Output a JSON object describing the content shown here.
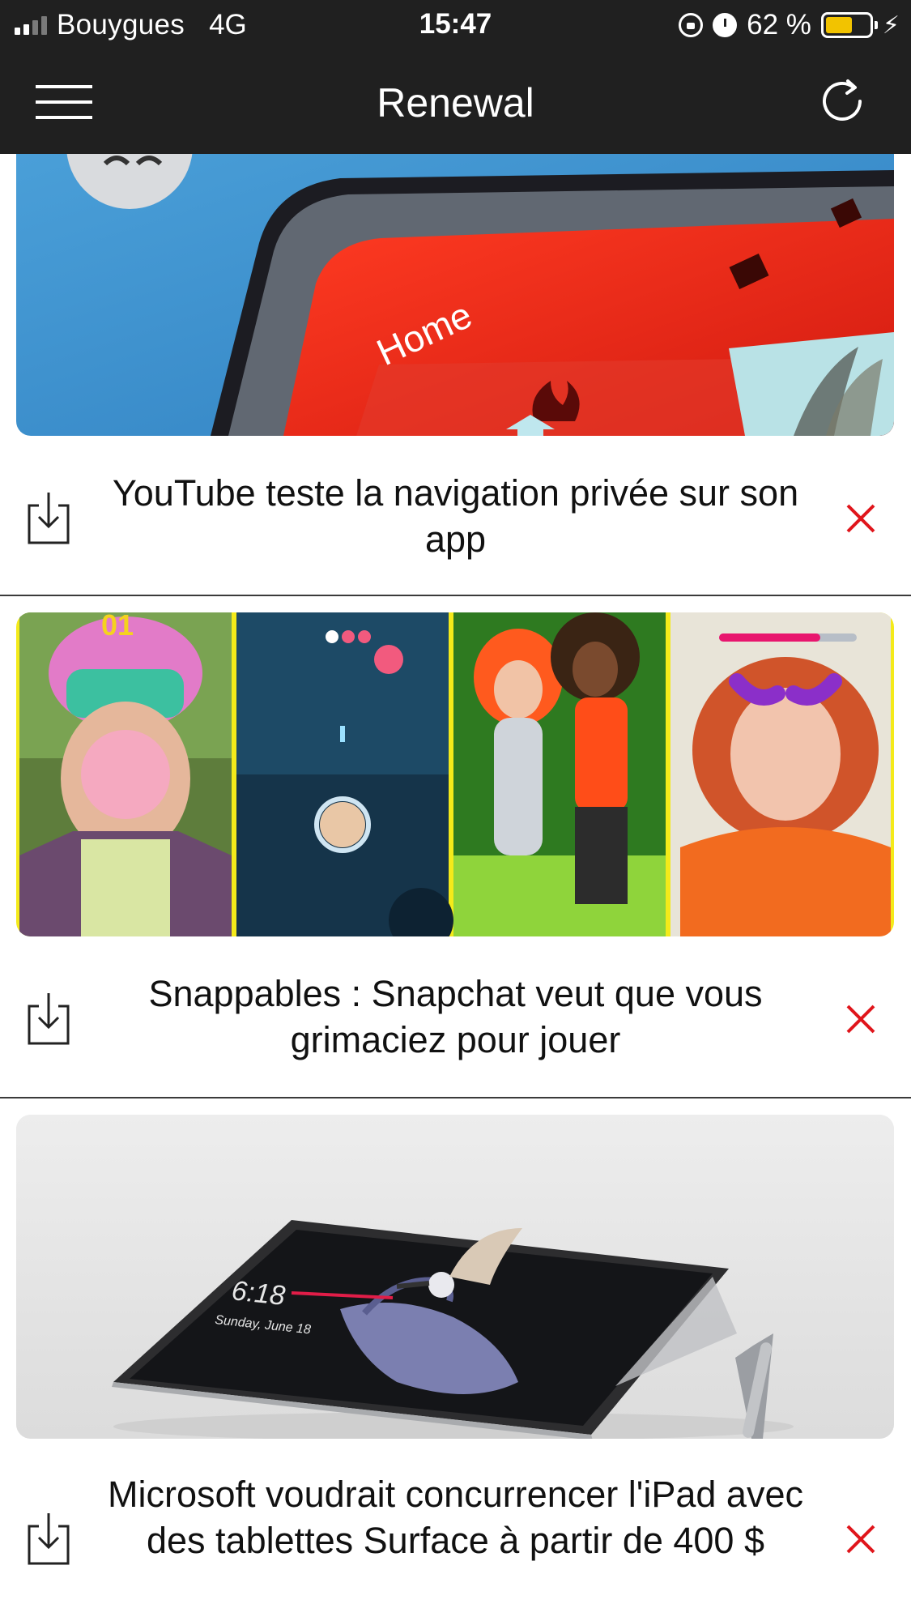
{
  "status_bar": {
    "carrier": "Bouygues",
    "network": "4G",
    "time": "15:47",
    "battery_percent": "62 %",
    "battery_level": 0.62,
    "battery_color": "#f2c300",
    "icons": [
      "signal-icon",
      "orientation-lock-icon",
      "alarm-icon",
      "battery-icon",
      "charging-bolt-icon"
    ]
  },
  "navbar": {
    "title": "Renewal",
    "left_icon": "hamburger-menu-icon",
    "right_icon": "refresh-icon"
  },
  "articles": [
    {
      "title": "YouTube teste la navigation privée sur son app",
      "image_text": "Home",
      "download_icon": "download-icon",
      "dismiss_icon": "close-icon"
    },
    {
      "title": "Snappables : Snapchat veut que vous grimaciez pour jouer",
      "image_text": "",
      "download_icon": "download-icon",
      "dismiss_icon": "close-icon"
    },
    {
      "title": "Microsoft voudrait concurrencer l'iPad avec des tablettes Surface à partir de 400 $",
      "image_text": "",
      "download_icon": "download-icon",
      "dismiss_icon": "close-icon"
    }
  ],
  "colors": {
    "bar_background": "#202020",
    "dismiss_red": "#e0151b",
    "divider": "#3a3a3a"
  }
}
